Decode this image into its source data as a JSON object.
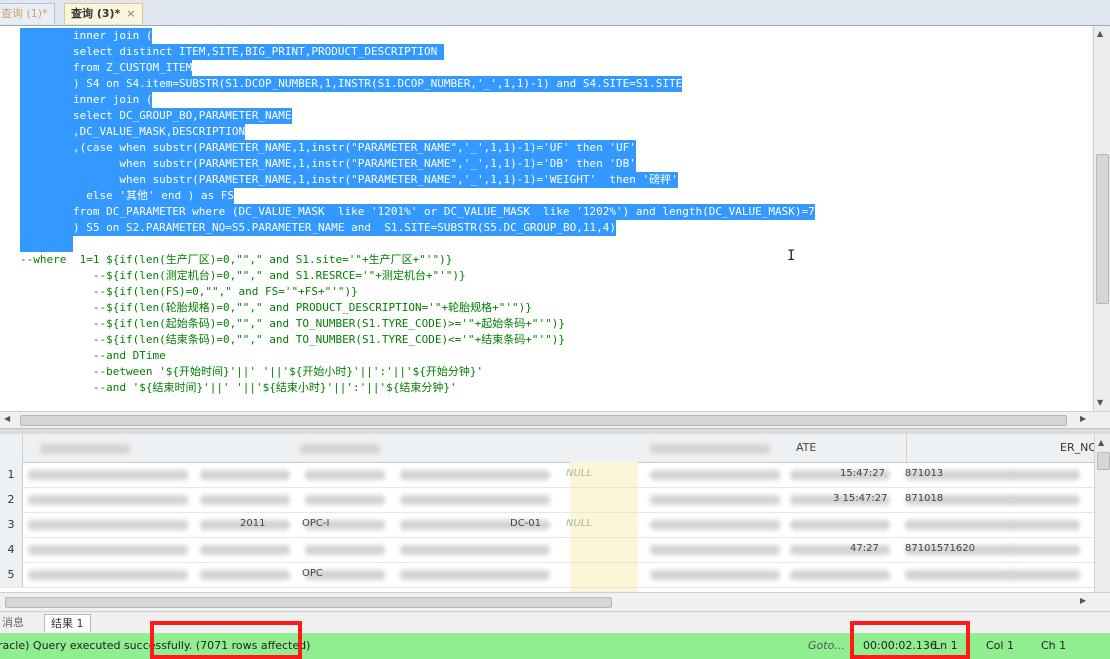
{
  "tabs": [
    {
      "label": "查询 (1)*"
    },
    {
      "label": "查询 (3)*"
    }
  ],
  "code_lines": [
    {
      "text": "        inner join (",
      "sel": true
    },
    {
      "text": "        select distinct ITEM,SITE,BIG_PRINT,PRODUCT_DESCRIPTION ",
      "sel": true
    },
    {
      "text": "        from Z_CUSTOM_ITEM",
      "sel": true
    },
    {
      "text": "        ) S4 on S4.item=SUBSTR(S1.DCOP_NUMBER,1,INSTR(S1.DCOP_NUMBER,'_',1,1)-1) and S4.SITE=S1.SITE",
      "sel": true
    },
    {
      "text": "        inner join (",
      "sel": true
    },
    {
      "text": "        select DC_GROUP_BO,PARAMETER_NAME",
      "sel": true
    },
    {
      "text": "        ,DC_VALUE_MASK,DESCRIPTION",
      "sel": true
    },
    {
      "text": "        ,(case when substr(PARAMETER_NAME,1,instr(\"PARAMETER_NAME\",'_',1,1)-1)='UF' then 'UF'",
      "sel": true
    },
    {
      "text": "               when substr(PARAMETER_NAME,1,instr(\"PARAMETER_NAME\",'_',1,1)-1)='DB' then 'DB'",
      "sel": true
    },
    {
      "text": "               when substr(PARAMETER_NAME,1,instr(\"PARAMETER_NAME\",'_',1,1)-1)='WEIGHT'  then '磅秤'",
      "sel": true
    },
    {
      "text": "          else '其他' end ) as FS",
      "sel": true
    },
    {
      "text": "        from DC_PARAMETER where (DC_VALUE_MASK  like '1201%' or DC_VALUE_MASK  like '1202%') and length(DC_VALUE_MASK)=7",
      "sel": true
    },
    {
      "text": "        ) S5 on S2.PARAMETER_NO=S5.PARAMETER_NAME and  S1.SITE=SUBSTR(S5.DC_GROUP_BO,11,4)",
      "sel": true
    },
    {
      "text": "        ",
      "sel": true
    },
    {
      "text": "--where  1=1 ${if(len(生产厂区)=0,\"\",\" and S1.site='\"+生产厂区+\"'\")}",
      "sel": false
    },
    {
      "text": "           --${if(len(测定机台)=0,\"\",\" and S1.RESRCE='\"+测定机台+\"'\")}",
      "sel": false
    },
    {
      "text": "           --${if(len(FS)=0,\"\",\" and FS='\"+FS+\"'\")}",
      "sel": false
    },
    {
      "text": "           --${if(len(轮胎规格)=0,\"\",\" and PRODUCT_DESCRIPTION='\"+轮胎规格+\"'\")}",
      "sel": false
    },
    {
      "text": "           --${if(len(起始条码)=0,\"\",\" and TO_NUMBER(S1.TYRE_CODE)>='\"+起始条码+\"'\")}",
      "sel": false
    },
    {
      "text": "           --${if(len(结束条码)=0,\"\",\" and TO_NUMBER(S1.TYRE_CODE)<='\"+结束条码+\"'\")}",
      "sel": false
    },
    {
      "text": "           --and DTime",
      "sel": false
    },
    {
      "text": "           --between '${开始时间}'||' '||'${开始小时}'||':'||'${开始分钟}'",
      "sel": false
    },
    {
      "text": "           --and '${结束时间}'||' '||'${结束小时}'||':'||'${结束分钟}'",
      "sel": false
    }
  ],
  "grid": {
    "header_right": "ER_NO",
    "header_mid": "ATE",
    "row_numbers": [
      "1",
      "2",
      "3",
      "4",
      "5"
    ],
    "null_label": "NULL",
    "fragments": {
      "r1_time": "15:47:27",
      "r1_code": "871013",
      "r2_time": "3 15:47:27",
      "r2_code": "871018",
      "r3_year": "2011",
      "r3_opc": "OPC-I",
      "r3_dc": "DC-01",
      "r4_time": "47:27",
      "r4_code": "87101571620",
      "r5_opc": "OPC"
    }
  },
  "bottom_tabs": [
    {
      "label": "消息"
    },
    {
      "label": "结果 1"
    }
  ],
  "status": {
    "message": "racle) Query executed successfully. (7071 rows affected)",
    "goto": "Goto...",
    "elapsed": "00:00:02.136",
    "ln": "Ln 1",
    "col": "Col 1",
    "ch": "Ch 1"
  },
  "colors": {
    "selection": "#3399ff",
    "comment": "#008000",
    "status_bar": "#90ee90",
    "highlight_box": "#ff1a1a"
  }
}
